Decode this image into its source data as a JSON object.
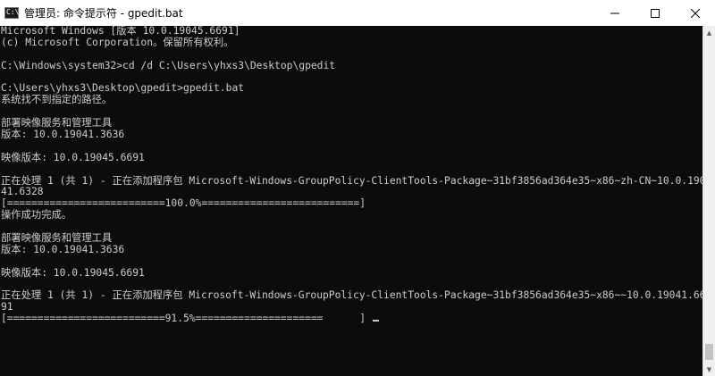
{
  "window": {
    "title": "管理员: 命令提示符 - gpedit.bat",
    "icon": "cmd-icon",
    "icon_glyph": "C:\\",
    "buttons": [
      "minimize",
      "maximize",
      "close"
    ]
  },
  "console": {
    "lines": [
      "Microsoft Windows [版本 10.0.19045.6691]",
      "(c) Microsoft Corporation。保留所有权利。",
      "",
      "C:\\Windows\\system32>cd /d C:\\Users\\yhxs3\\Desktop\\gpedit",
      "",
      "C:\\Users\\yhxs3\\Desktop\\gpedit>gpedit.bat",
      "系统找不到指定的路径。",
      "",
      "部署映像服务和管理工具",
      "版本: 10.0.19041.3636",
      "",
      "映像版本: 10.0.19045.6691",
      "",
      "正在处理 1 (共 1) - 正在添加程序包 Microsoft-Windows-GroupPolicy-ClientTools-Package~31bf3856ad364e35~x86~zh-CN~10.0.190",
      "41.6328",
      "[==========================100.0%==========================]",
      "操作成功完成。",
      "",
      "部署映像服务和管理工具",
      "版本: 10.0.19041.3636",
      "",
      "映像版本: 10.0.19045.6691",
      "",
      "正在处理 1 (共 1) - 正在添加程序包 Microsoft-Windows-GroupPolicy-ClientTools-Package~31bf3856ad364e35~x86~~10.0.19041.66",
      "91",
      "[==========================91.5%=====================      ]"
    ]
  },
  "colors": {
    "console_bg": "#0c0c0c",
    "console_fg": "#cccccc",
    "titlebar_bg": "#ffffff"
  }
}
